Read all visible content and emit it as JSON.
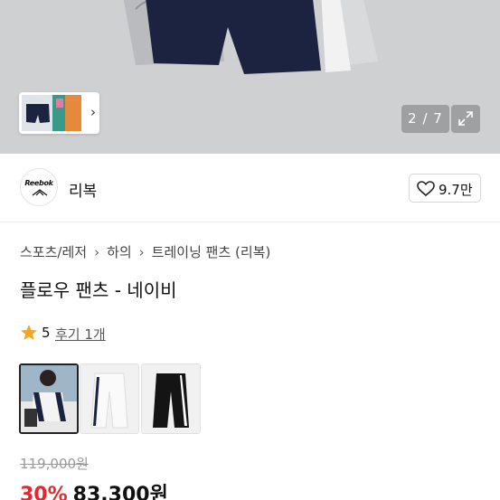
{
  "gallery": {
    "counter": "2 / 7",
    "icons": {
      "expand": "expand-icon",
      "chevron": "chevron-right-icon"
    }
  },
  "brand": {
    "logo_text": "Reebok",
    "name": "리복",
    "like_count": "9.7만",
    "icons": {
      "like": "heart-outline-icon"
    }
  },
  "breadcrumb": [
    "스포츠/레저",
    "하의",
    "트레이닝 팬츠 (리복)"
  ],
  "product": {
    "title": "플로우 팬츠 - 네이비",
    "rating": "5",
    "review_link": "후기 1개",
    "original_price": "119,000원",
    "discount": "30%",
    "sale_price": "83,300원"
  },
  "options": [
    "model-photo",
    "white-pants",
    "black-pants"
  ],
  "colors": {
    "accent_red": "#e8262b",
    "star": "#f5a623",
    "navy": "#1c2340"
  }
}
